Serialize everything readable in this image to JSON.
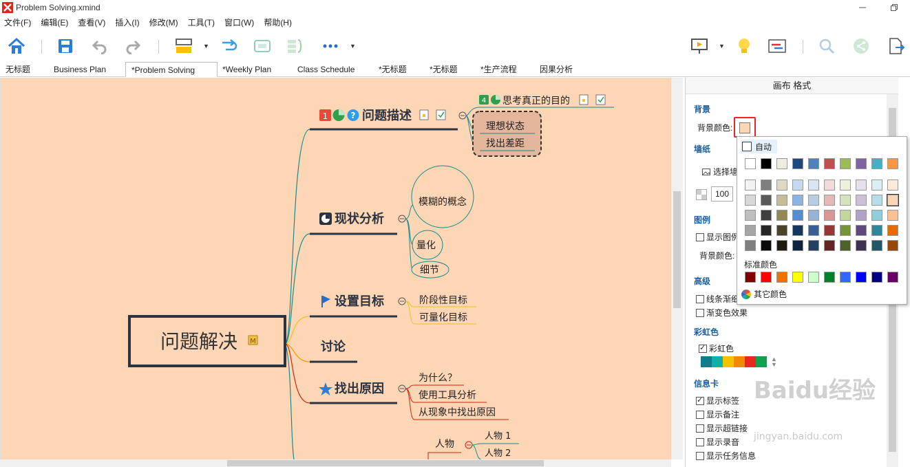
{
  "window": {
    "title": "Problem Solving.xmind"
  },
  "menu": [
    "文件(F)",
    "编辑(E)",
    "查看(V)",
    "插入(I)",
    "修改(M)",
    "工具(T)",
    "窗口(W)",
    "帮助(H)"
  ],
  "tabs": [
    "无标题",
    "Business Plan",
    "*Problem Solving",
    "*Weekly Plan",
    "Class Schedule",
    "*无标题",
    "*无标题",
    "*生产流程",
    "因果分析"
  ],
  "active_tab": "*Problem Solving",
  "map": {
    "central": "问题解决",
    "central_marker": "M",
    "topics": {
      "t1": {
        "label": "问题描述",
        "marker1": "1",
        "marker3": "?"
      },
      "t2": {
        "label": "现状分析"
      },
      "t3": {
        "label": "设置目标"
      },
      "t4": {
        "label": "讨论"
      },
      "t5": {
        "label": "找出原因"
      }
    },
    "subtopics": {
      "s_think": {
        "label": "思考真正的目的",
        "marker": "4"
      },
      "s_ideal": "理想状态",
      "s_gap": "找出差距",
      "s_fuzzy": "模糊的概念",
      "s_quant": "量化",
      "s_detail": "细节",
      "s_stage": "阶段性目标",
      "s_quantgoal": "可量化目标",
      "s_why": "为什么？",
      "s_tool": "使用工具分析",
      "s_phen": "从现象中找出原因",
      "s_person": "人物",
      "s_p1": "人物 1",
      "s_p2": "人物 2"
    }
  },
  "panel": {
    "title": "画布 格式",
    "background_section": "背景",
    "background_color_label": "背景颜色:",
    "wallpaper_section": "墙纸",
    "select_wallpaper": "选择墙",
    "opacity_value": "100",
    "legend_section": "图例",
    "show_legend": "显示图例",
    "legend_bg_label": "背景颜色:",
    "advanced_section": "高级",
    "line_taper": "线条渐细",
    "gradient": "渐变色效果",
    "rainbow_section": "彩虹色",
    "rainbow_label": "彩虹色",
    "rainbow_colors": [
      "#0f7b8f",
      "#10b0a8",
      "#f5c200",
      "#f08a00",
      "#e8281e",
      "#10a050"
    ],
    "info_section": "信息卡",
    "show_labels": "显示标签",
    "show_notes": "显示备注",
    "show_hyperlinks": "显示超链接",
    "show_audio": "显示录音",
    "show_task_info": "显示任务信息"
  },
  "color_picker": {
    "auto_label": "自动",
    "standard_label": "标准颜色",
    "more_label": "其它颜色",
    "theme_top": [
      "#ffffff",
      "#000000",
      "#eeece1",
      "#1f497d",
      "#4f81bd",
      "#c0504d",
      "#9bbb59",
      "#8064a2",
      "#4bacc6",
      "#f79646"
    ],
    "theme_shades": [
      [
        "#f2f2f2",
        "#7f7f7f",
        "#ddd9c3",
        "#c6d9f0",
        "#dbe5f1",
        "#f2dcdb",
        "#ebf1dd",
        "#e5e0ec",
        "#dbeef3",
        "#fdeada"
      ],
      [
        "#d8d8d8",
        "#595959",
        "#c4bd97",
        "#8db3e2",
        "#b8cce4",
        "#e5b9b7",
        "#d7e3bc",
        "#ccc1d9",
        "#b7dde8",
        "#fbd5b5"
      ],
      [
        "#bfbfbf",
        "#3f3f3f",
        "#938953",
        "#548dd4",
        "#95b3d7",
        "#d99694",
        "#c3d69b",
        "#b2a2c7",
        "#92cddc",
        "#fac08f"
      ],
      [
        "#a5a5a5",
        "#262626",
        "#494429",
        "#17365d",
        "#366092",
        "#953734",
        "#76923c",
        "#5f497a",
        "#31859b",
        "#e36c09"
      ],
      [
        "#7f7f7f",
        "#0c0c0c",
        "#1d1b10",
        "#0f243e",
        "#244061",
        "#632423",
        "#4f6128",
        "#3f3151",
        "#205867",
        "#974806"
      ]
    ],
    "standard": [
      "#7f0000",
      "#ff0000",
      "#f07000",
      "#ffff00",
      "#ccffcc",
      "#00802b",
      "#3366ff",
      "#0000ff",
      "#000080",
      "#660066"
    ],
    "selected": "#fbd5b5"
  },
  "colors": {
    "canvas_bg": "#fdd6b6",
    "central_border": "#2b3240",
    "branch_blue": "#1a8a8a",
    "branch_yellow": "#f0c020",
    "branch_red": "#d82010"
  },
  "watermark": {
    "main": "Baidu经验",
    "sub": "jingyan.baidu.com"
  }
}
